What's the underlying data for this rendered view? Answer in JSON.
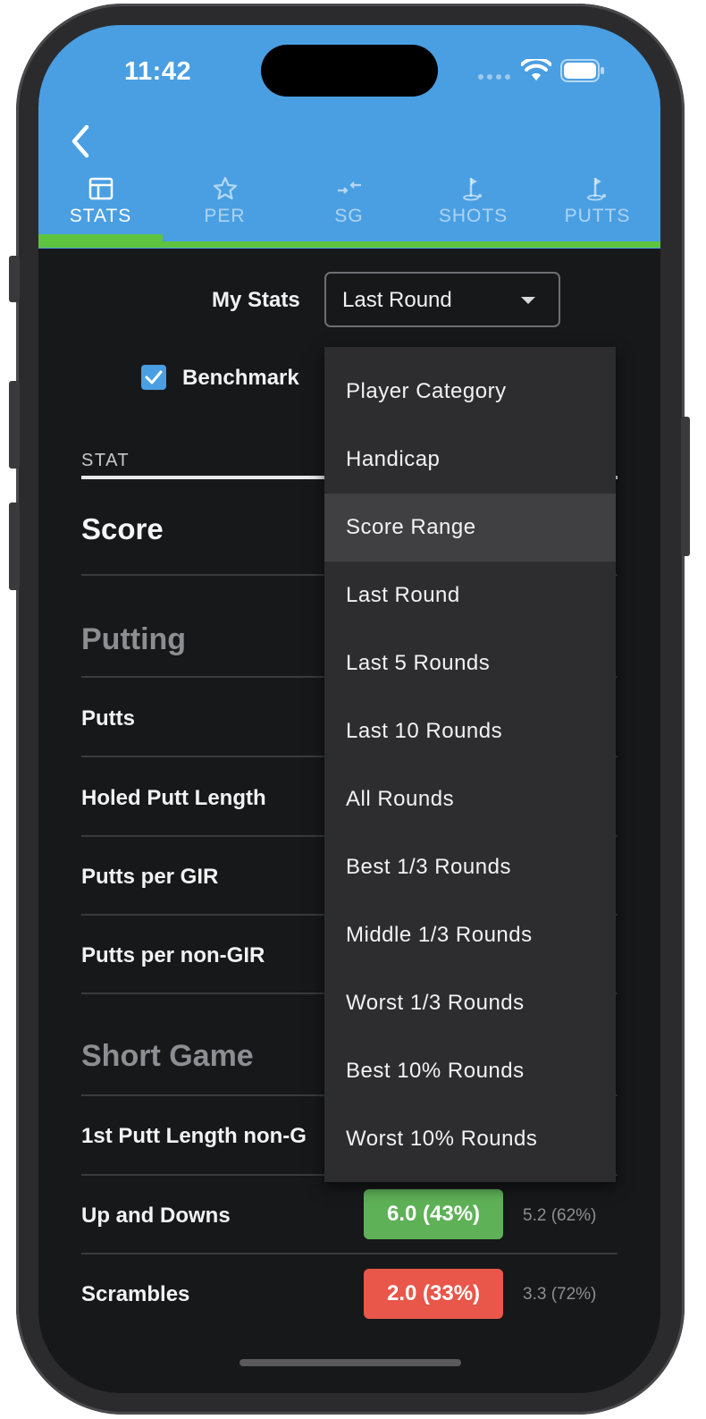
{
  "status_bar": {
    "time": "11:42"
  },
  "tabs": [
    {
      "label": "STATS",
      "icon": "table-icon"
    },
    {
      "label": "PER",
      "icon": "star-icon"
    },
    {
      "label": "SG",
      "icon": "arrows-icon"
    },
    {
      "label": "SHOTS",
      "icon": "flag-icon"
    },
    {
      "label": "PUTTS",
      "icon": "flag-icon"
    }
  ],
  "controls": {
    "my_stats_label": "My Stats",
    "my_stats_value": "Last Round",
    "benchmark_label": "Benchmark",
    "benchmark_checked": true
  },
  "table": {
    "header": "STAT",
    "score_label": "Score",
    "sections": {
      "putting": "Putting",
      "short_game": "Short Game"
    },
    "rows": [
      "Putts",
      "Holed Putt Length",
      "Putts per GIR",
      "Putts per non-GIR",
      "1st Putt Length non-G"
    ],
    "up_downs": {
      "label": "Up and Downs",
      "value": "6.0 (43%)",
      "benchmark": "5.2 (62%)",
      "color": "#5fb157"
    },
    "scrambles": {
      "label": "Scrambles",
      "value": "2.0 (33%)",
      "benchmark": "3.3 (72%)",
      "color": "#e8574a"
    }
  },
  "dropdown": {
    "options": [
      "Player Category",
      "Handicap",
      "Score Range",
      "Last Round",
      "Last 5 Rounds",
      "Last 10 Rounds",
      "All Rounds",
      "Best 1/3 Rounds",
      "Middle 1/3 Rounds",
      "Worst 1/3 Rounds",
      "Best 10% Rounds",
      "Worst 10% Rounds"
    ],
    "highlighted": "Score Range"
  },
  "colors": {
    "header_blue": "#4a9fe3",
    "accent_green": "#5ec33e",
    "background": "#17181a"
  }
}
